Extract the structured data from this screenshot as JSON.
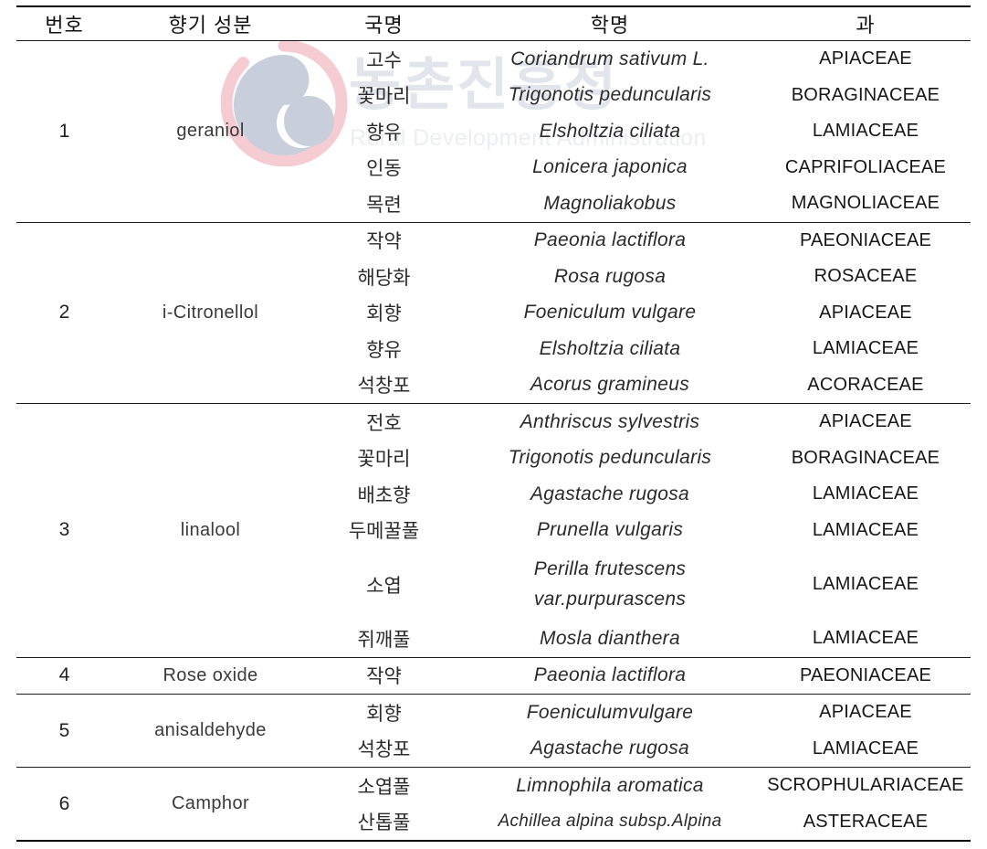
{
  "watermark": {
    "korean_text": "농촌진흥청",
    "english_text": "Rural Development Administration",
    "logo_name": "rural-development-administration-logo",
    "colors": {
      "outer_arc": "#f6ccd3",
      "inner_spiral": "#c8cfdb",
      "korean_text": "#e2e6ec",
      "english_text": "#eceef1"
    }
  },
  "table": {
    "headers": [
      "번호",
      "향기 성분",
      "국명",
      "학명",
      "과"
    ],
    "groups": [
      {
        "number": "1",
        "compound": "geraniol",
        "rows": [
          {
            "korean_name": "고수",
            "scientific_name": "Coriandrum sativum L.",
            "family": "APIACEAE"
          },
          {
            "korean_name": "꽃마리",
            "scientific_name": "Trigonotis peduncularis",
            "family": "BORAGINACEAE"
          },
          {
            "korean_name": "향유",
            "scientific_name": "Elsholtzia ciliata",
            "family": "LAMIACEAE"
          },
          {
            "korean_name": "인동",
            "scientific_name": "Lonicera japonica",
            "family": "CAPRIFOLIACEAE"
          },
          {
            "korean_name": "목련",
            "scientific_name": "Magnoliakobus",
            "family": "MAGNOLIACEAE"
          }
        ]
      },
      {
        "number": "2",
        "compound": "i-Citronellol",
        "rows": [
          {
            "korean_name": "작약",
            "scientific_name": "Paeonia lactiflora",
            "family": "PAEONIACEAE"
          },
          {
            "korean_name": "해당화",
            "scientific_name": "Rosa rugosa",
            "family": "ROSACEAE"
          },
          {
            "korean_name": "회향",
            "scientific_name": "Foeniculum vulgare",
            "family": "APIACEAE"
          },
          {
            "korean_name": "향유",
            "scientific_name": "Elsholtzia ciliata",
            "family": "LAMIACEAE"
          },
          {
            "korean_name": "석창포",
            "scientific_name": "Acorus gramineus",
            "family": "ACORACEAE"
          }
        ]
      },
      {
        "number": "3",
        "compound": "linalool",
        "rows": [
          {
            "korean_name": "전호",
            "scientific_name": "Anthriscus sylvestris",
            "family": "APIACEAE"
          },
          {
            "korean_name": "꽃마리",
            "scientific_name": "Trigonotis peduncularis",
            "family": "BORAGINACEAE"
          },
          {
            "korean_name": "배초향",
            "scientific_name": "Agastache rugosa",
            "family": "LAMIACEAE"
          },
          {
            "korean_name": "두메꿀풀",
            "scientific_name": "Prunella vulgaris",
            "family": "LAMIACEAE"
          },
          {
            "korean_name": "소엽",
            "scientific_name": "Perilla frutescens",
            "scientific_name_line2": "var.purpurascens",
            "family": "LAMIACEAE"
          },
          {
            "korean_name": "쥐깨풀",
            "scientific_name": "Mosla dianthera",
            "family": "LAMIACEAE"
          }
        ]
      },
      {
        "number": "4",
        "compound": "Rose oxide",
        "rows": [
          {
            "korean_name": "작약",
            "scientific_name": "Paeonia lactiflora",
            "family": "PAEONIACEAE"
          }
        ]
      },
      {
        "number": "5",
        "compound": "anisaldehyde",
        "rows": [
          {
            "korean_name": "회향",
            "scientific_name": "Foeniculumvulgare",
            "family": "APIACEAE"
          },
          {
            "korean_name": "석창포",
            "scientific_name": "Agastache rugosa",
            "family": "LAMIACEAE"
          }
        ]
      },
      {
        "number": "6",
        "compound": "Camphor",
        "rows": [
          {
            "korean_name": "소엽풀",
            "scientific_name": "Limnophila aromatica",
            "family": "SCROPHULARIACEAE"
          },
          {
            "korean_name": "산톱풀",
            "scientific_name": "Achillea alpina subsp.Alpina",
            "family": "ASTERACEAE"
          }
        ]
      }
    ]
  }
}
